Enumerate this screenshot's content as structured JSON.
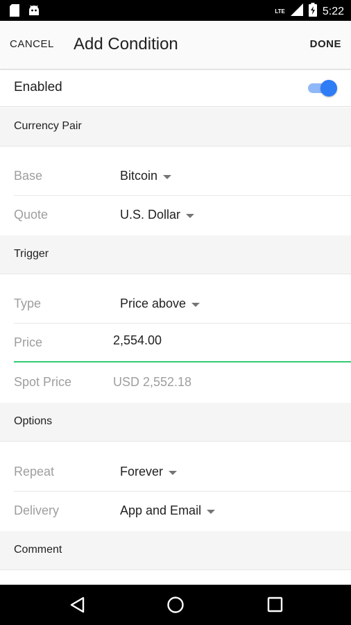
{
  "status_bar": {
    "time": "5:22",
    "network": "LTE",
    "left_icons": [
      "sd-card-icon",
      "android-icon"
    ],
    "right_icons": [
      "signal-icon",
      "battery-icon"
    ]
  },
  "toolbar": {
    "cancel_label": "CANCEL",
    "title": "Add Condition",
    "done_label": "DONE"
  },
  "enabled": {
    "label": "Enabled",
    "value": true,
    "accent_color": "#2e7cf6"
  },
  "sections": {
    "currency_pair": {
      "header": "Currency Pair",
      "base_label": "Base",
      "base_value": "Bitcoin",
      "quote_label": "Quote",
      "quote_value": "U.S. Dollar"
    },
    "trigger": {
      "header": "Trigger",
      "type_label": "Type",
      "type_value": "Price above",
      "price_label": "Price",
      "price_value": "2,554.00",
      "spot_label": "Spot Price",
      "spot_value": "USD 2,552.18",
      "focus_color": "#2ecc71"
    },
    "options": {
      "header": "Options",
      "repeat_label": "Repeat",
      "repeat_value": "Forever",
      "delivery_label": "Delivery",
      "delivery_value": "App and Email"
    },
    "comment": {
      "header": "Comment"
    }
  },
  "nav_bar": {
    "buttons": [
      "back-icon",
      "home-icon",
      "recents-icon"
    ]
  }
}
